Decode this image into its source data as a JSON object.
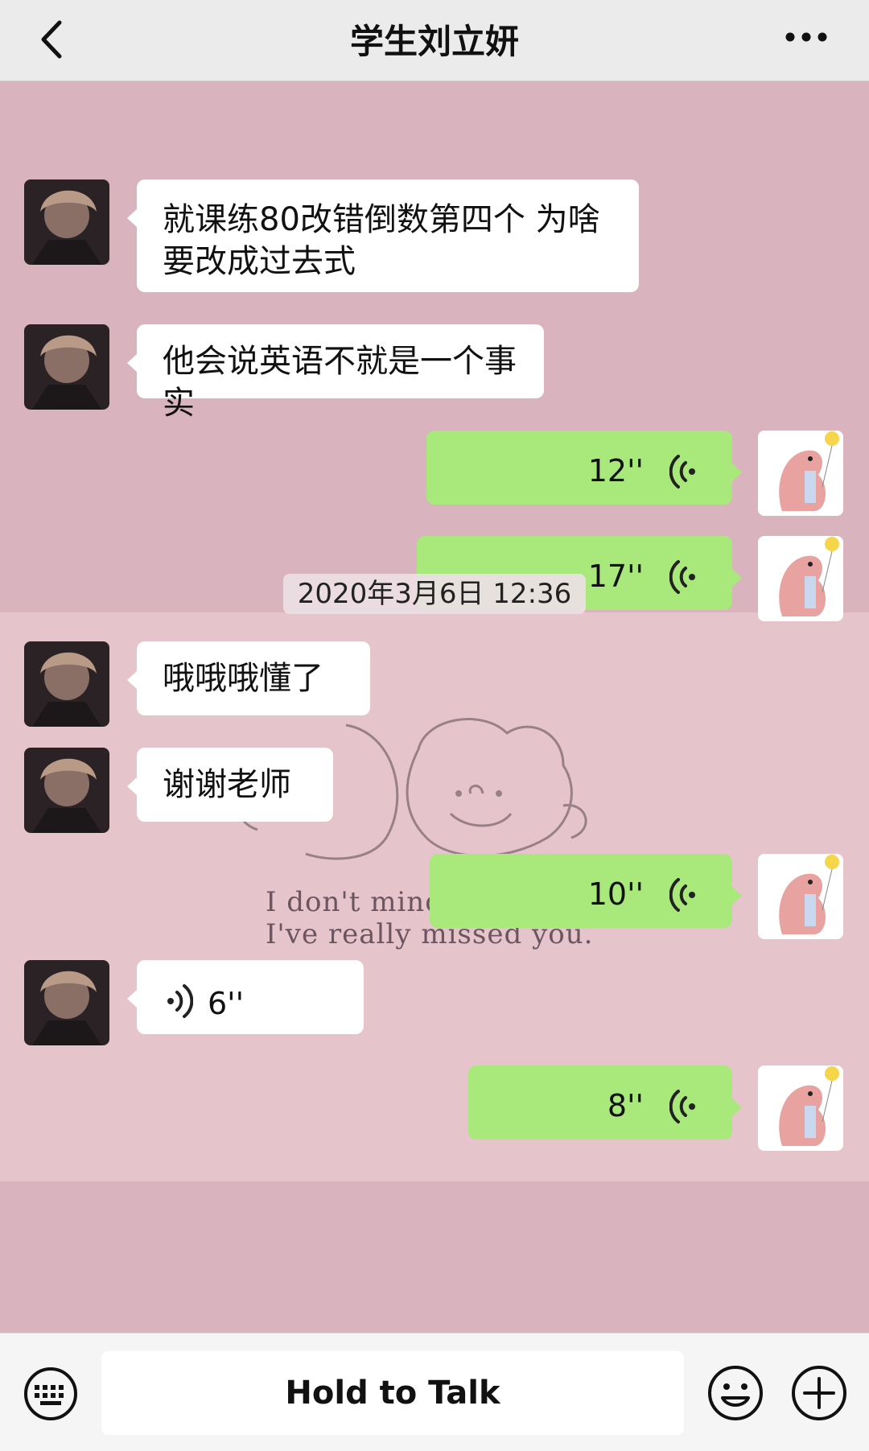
{
  "header": {
    "title": "学生刘立妍",
    "back_icon": "chevron-left-icon",
    "more_icon": "more-dots-icon"
  },
  "messages": [
    {
      "side": "in",
      "type": "text",
      "text": "就课练80改错倒数第四个 为啥要改成过去式"
    },
    {
      "side": "in",
      "type": "text",
      "text": "他会说英语不就是一个事实"
    },
    {
      "side": "out",
      "type": "voice",
      "duration": "12''"
    },
    {
      "side": "out",
      "type": "voice",
      "duration": "17''"
    },
    {
      "side": "in",
      "type": "text",
      "text": "哦哦哦懂了"
    },
    {
      "side": "in",
      "type": "text",
      "text": "谢谢老师"
    },
    {
      "side": "out",
      "type": "voice",
      "duration": "10''"
    },
    {
      "side": "in",
      "type": "voice",
      "duration": "6''"
    },
    {
      "side": "out",
      "type": "voice",
      "duration": "8''"
    }
  ],
  "timestamp": "2020年3月6日 12:36",
  "wallpaper": {
    "line1": "I don't mind telling you",
    "line2": "I've really missed you."
  },
  "bottom_bar": {
    "talk_label": "Hold to Talk",
    "keyboard_icon": "keyboard-icon",
    "emoji_icon": "emoji-icon",
    "plus_icon": "plus-circle-icon"
  },
  "colors": {
    "chat_bg": "#d9b3bd",
    "outgoing_bubble": "#a9e87b",
    "incoming_bubble": "#ffffff",
    "header_bg": "#ebebeb"
  }
}
